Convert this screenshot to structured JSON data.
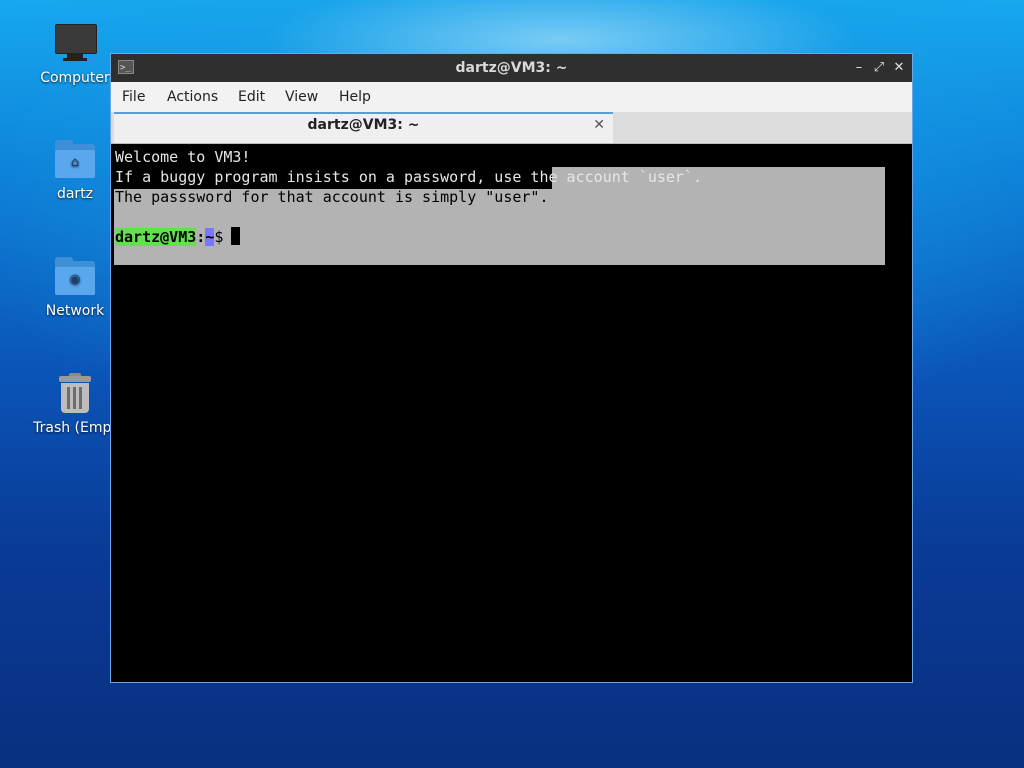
{
  "desktop": {
    "icons": [
      {
        "label": "Computer",
        "icon": "computer-icon"
      },
      {
        "label": "dartz",
        "icon": "home-folder-icon"
      },
      {
        "label": "Network",
        "icon": "network-folder-icon"
      },
      {
        "label": "Trash (Empt",
        "icon": "trash-icon"
      }
    ]
  },
  "window": {
    "title": "dartz@VM3: ~",
    "controls": {
      "minimize": "–",
      "maximize": "⤢",
      "close": "✕"
    },
    "menu": [
      "File",
      "Actions",
      "Edit",
      "View",
      "Help"
    ],
    "tab": {
      "title": "dartz@VM3: ~",
      "close": "✕"
    }
  },
  "terminal": {
    "lines": [
      "Welcome to VM3!",
      "If a buggy program insists on a password, use the account `user`.",
      "The passsword for that account is simply \"user\"."
    ],
    "prompt": {
      "user_host": "dartz@VM3",
      "colon": ":",
      "path": "~",
      "symbol": "$"
    },
    "colors": {
      "selection": "#b3b3b3",
      "user_host": "#63e04f",
      "path": "#7777ff"
    }
  }
}
